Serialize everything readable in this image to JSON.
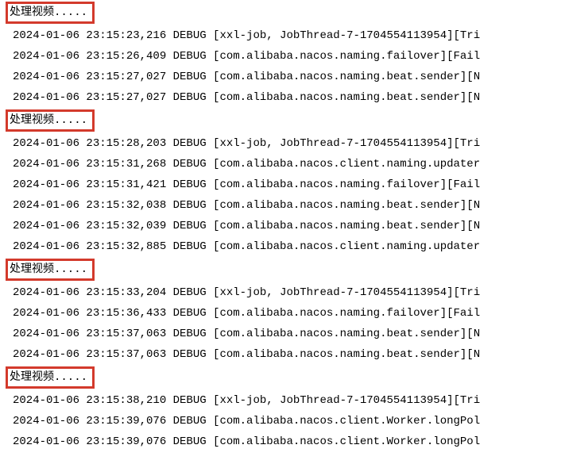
{
  "highlight_text": "处理视频.....",
  "blocks": [
    {
      "marker": "处理视频.....",
      "lines": [
        "2024-01-06 23:15:23,216 DEBUG [xxl-job, JobThread-7-1704554113954][Tri",
        "2024-01-06 23:15:26,409 DEBUG [com.alibaba.nacos.naming.failover][Fail",
        "2024-01-06 23:15:27,027 DEBUG [com.alibaba.nacos.naming.beat.sender][N",
        "2024-01-06 23:15:27,027 DEBUG [com.alibaba.nacos.naming.beat.sender][N"
      ]
    },
    {
      "marker": "处理视频.....",
      "lines": [
        "2024-01-06 23:15:28,203 DEBUG [xxl-job, JobThread-7-1704554113954][Tri",
        "2024-01-06 23:15:31,268 DEBUG [com.alibaba.nacos.client.naming.updater",
        "2024-01-06 23:15:31,421 DEBUG [com.alibaba.nacos.naming.failover][Fail",
        "2024-01-06 23:15:32,038 DEBUG [com.alibaba.nacos.naming.beat.sender][N",
        "2024-01-06 23:15:32,039 DEBUG [com.alibaba.nacos.naming.beat.sender][N",
        "2024-01-06 23:15:32,885 DEBUG [com.alibaba.nacos.client.naming.updater"
      ]
    },
    {
      "marker": "处理视频.....",
      "lines": [
        "2024-01-06 23:15:33,204 DEBUG [xxl-job, JobThread-7-1704554113954][Tri",
        "2024-01-06 23:15:36,433 DEBUG [com.alibaba.nacos.naming.failover][Fail",
        "2024-01-06 23:15:37,063 DEBUG [com.alibaba.nacos.naming.beat.sender][N",
        "2024-01-06 23:15:37,063 DEBUG [com.alibaba.nacos.naming.beat.sender][N"
      ]
    },
    {
      "marker": "处理视频.....",
      "lines": [
        "2024-01-06 23:15:38,210 DEBUG [xxl-job, JobThread-7-1704554113954][Tri",
        "2024-01-06 23:15:39,076 DEBUG [com.alibaba.nacos.client.Worker.longPol",
        "2024-01-06 23:15:39,076 DEBUG [com.alibaba.nacos.client.Worker.longPol"
      ]
    }
  ]
}
